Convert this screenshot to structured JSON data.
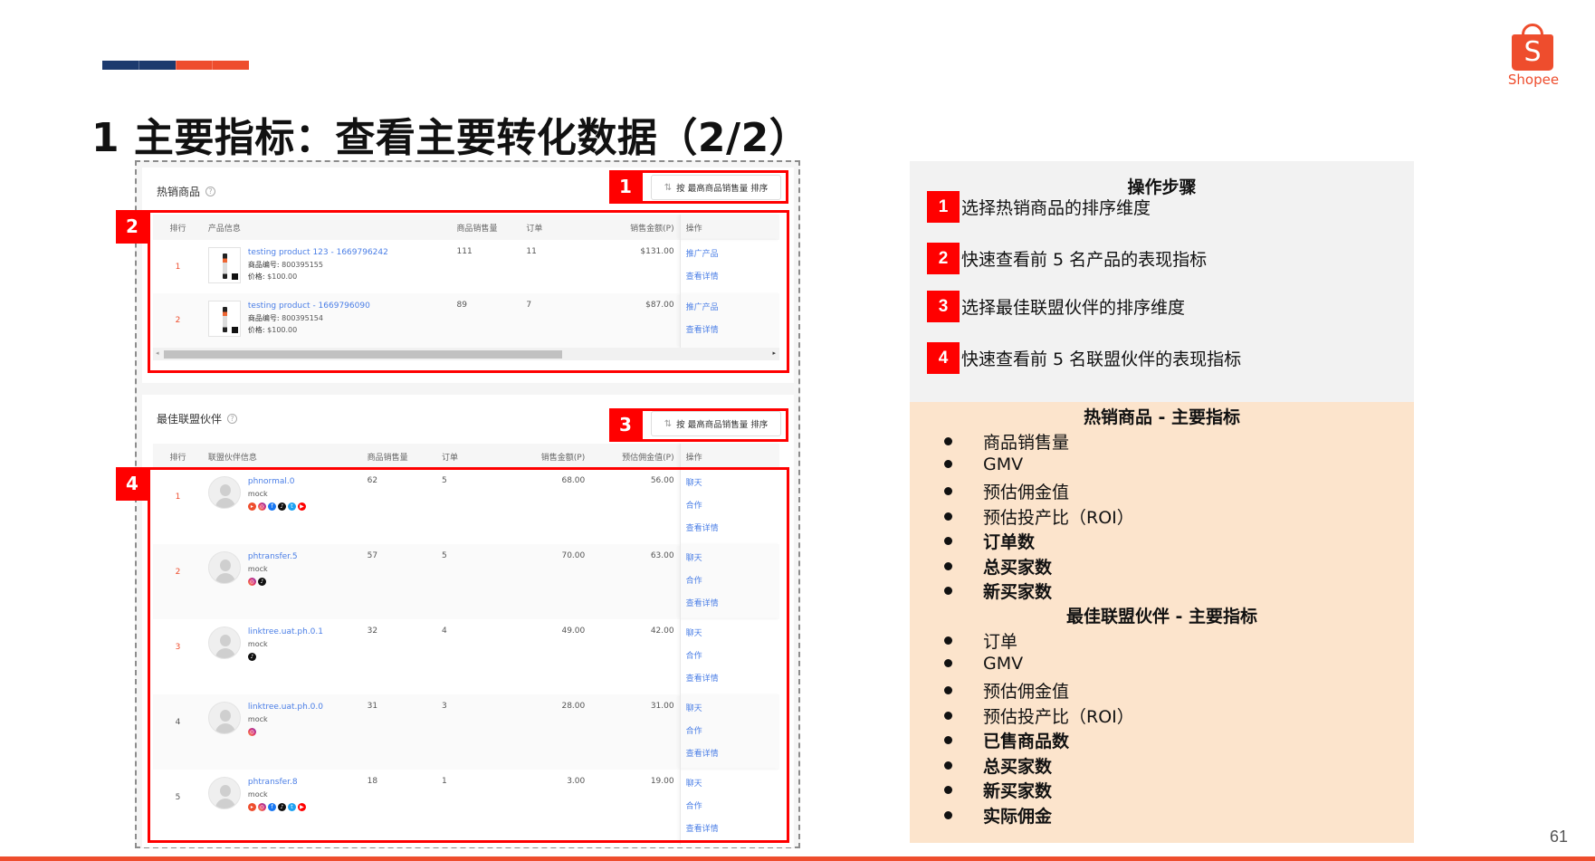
{
  "colors": {
    "brand_orange": "#ee4d2d",
    "accent_navy": "#1c3a6e",
    "annotation_red": "#ff0000",
    "link_blue": "#4a7ee6",
    "steps_bg": "#f2f2f2",
    "metrics_bg": "#fce4cc"
  },
  "logo": {
    "icon": "shopping-bag-icon",
    "letter": "S",
    "text": "Shopee"
  },
  "title": "1 主要指标：查看主要转化数据（2/2）",
  "hot_products": {
    "title": "热销商品",
    "help_icon": "?",
    "sort_icon": "⇅",
    "sort_label": "按 最高商品销售量 排序",
    "columns": [
      "排行",
      "产品信息",
      "商品销售量",
      "订单",
      "销售金额(P)",
      "操作"
    ],
    "rows": [
      {
        "rank": "1",
        "name": "testing product 123 - 1669796242",
        "id_label": "商品编号:",
        "id": "800395155",
        "price_label": "价格:",
        "price": "$100.00",
        "units": "111",
        "orders": "11",
        "sales": "$131.00",
        "actions": [
          "推广产品",
          "查看详情"
        ]
      },
      {
        "rank": "2",
        "name": "testing product - 1669796090",
        "id_label": "商品编号:",
        "id": "800395154",
        "price_label": "价格:",
        "price": "$100.00",
        "units": "89",
        "orders": "7",
        "sales": "$87.00",
        "actions": [
          "推广产品",
          "查看详情"
        ]
      }
    ],
    "scroll": {
      "left_arrow": "◂",
      "right_arrow": "▸"
    }
  },
  "affiliates": {
    "title": "最佳联盟伙伴",
    "help_icon": "?",
    "sort_icon": "⇅",
    "sort_label": "按 最高商品销售量 排序",
    "columns": [
      "排行",
      "联盟伙伴信息",
      "商品销售量",
      "订单",
      "销售金额(P)",
      "预估佣金值(P)",
      "操作"
    ],
    "rows": [
      {
        "rank": "1",
        "name": "phnormal.0",
        "sub": "mock",
        "socials": [
          "shopee-live",
          "instagram",
          "facebook",
          "tiktok",
          "twitter",
          "youtube"
        ],
        "units": "62",
        "orders": "5",
        "sales": "68.00",
        "commission": "56.00",
        "actions": [
          "聊天",
          "合作",
          "查看详情"
        ]
      },
      {
        "rank": "2",
        "name": "phtransfer.5",
        "sub": "mock",
        "socials": [
          "instagram",
          "tiktok"
        ],
        "units": "57",
        "orders": "5",
        "sales": "70.00",
        "commission": "63.00",
        "actions": [
          "聊天",
          "合作",
          "查看详情"
        ]
      },
      {
        "rank": "3",
        "name": "linktree.uat.ph.0.1",
        "sub": "mock",
        "socials": [
          "tiktok"
        ],
        "units": "32",
        "orders": "4",
        "sales": "49.00",
        "commission": "42.00",
        "actions": [
          "聊天",
          "合作",
          "查看详情"
        ]
      },
      {
        "rank": "4",
        "name": "linktree.uat.ph.0.0",
        "sub": "mock",
        "socials": [
          "instagram"
        ],
        "units": "31",
        "orders": "3",
        "sales": "28.00",
        "commission": "31.00",
        "actions": [
          "聊天",
          "合作",
          "查看详情"
        ]
      },
      {
        "rank": "5",
        "name": "phtransfer.8",
        "sub": "mock",
        "socials": [
          "shopee-live",
          "instagram",
          "facebook",
          "tiktok",
          "twitter",
          "youtube"
        ],
        "units": "18",
        "orders": "1",
        "sales": "3.00",
        "commission": "19.00",
        "actions": [
          "聊天",
          "合作",
          "查看详情"
        ]
      }
    ]
  },
  "annotations": [
    "1",
    "2",
    "3",
    "4"
  ],
  "steps": {
    "title": "操作步骤",
    "items": [
      {
        "num": "1",
        "text": "选择热销商品的排序维度"
      },
      {
        "num": "2",
        "text": "快速查看前 5 名产品的表现指标"
      },
      {
        "num": "3",
        "text": "选择最佳联盟伙伴的排序维度"
      },
      {
        "num": "4",
        "text": "快速查看前 5 名联盟伙伴的表现指标"
      }
    ]
  },
  "metrics": {
    "hot_title": "热销商品 - 主要指标",
    "hot_items": [
      {
        "text": "商品销售量",
        "bold": false
      },
      {
        "text": "GMV",
        "bold": false
      },
      {
        "text": "预估佣金值",
        "bold": false
      },
      {
        "text": "预估投产比（ROI）",
        "bold": false
      },
      {
        "text": "订单数",
        "bold": true
      },
      {
        "text": "总买家数",
        "bold": true
      },
      {
        "text": "新买家数",
        "bold": true
      }
    ],
    "aff_title": "最佳联盟伙伴 - 主要指标",
    "aff_items": [
      {
        "text": "订单",
        "bold": false
      },
      {
        "text": "GMV",
        "bold": false
      },
      {
        "text": "预估佣金值",
        "bold": false
      },
      {
        "text": "预估投产比（ROI）",
        "bold": false
      },
      {
        "text": "已售商品数",
        "bold": true
      },
      {
        "text": "总买家数",
        "bold": true
      },
      {
        "text": "新买家数",
        "bold": true
      },
      {
        "text": "实际佣金",
        "bold": true
      }
    ]
  },
  "page_number": "61"
}
